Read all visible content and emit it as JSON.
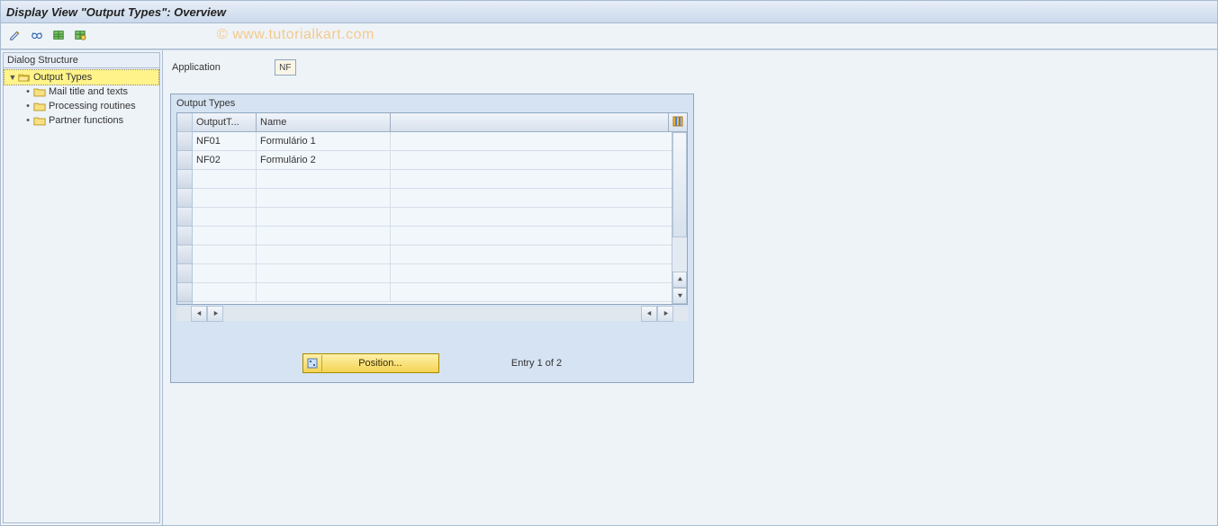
{
  "title": "Display View \"Output Types\": Overview",
  "watermark": "© www.tutorialkart.com",
  "toolbar": {
    "t1": "change-icon",
    "t2": "glasses-icon",
    "t3": "table-icon",
    "t4": "table-settings-icon"
  },
  "tree": {
    "header": "Dialog Structure",
    "root": {
      "label": "Output Types",
      "expanded": true
    },
    "children": [
      {
        "label": "Mail title and texts"
      },
      {
        "label": "Processing routines"
      },
      {
        "label": "Partner functions"
      }
    ]
  },
  "application": {
    "label": "Application",
    "value": "NF"
  },
  "panel": {
    "title": "Output Types",
    "columns": {
      "output": "OutputT...",
      "name": "Name"
    },
    "rows": [
      {
        "output": "NF01",
        "name": "Formulário 1"
      },
      {
        "output": "NF02",
        "name": "Formulário 2"
      }
    ],
    "emptyRows": 7,
    "positionLabel": "Position...",
    "entryText": "Entry 1 of 2"
  }
}
